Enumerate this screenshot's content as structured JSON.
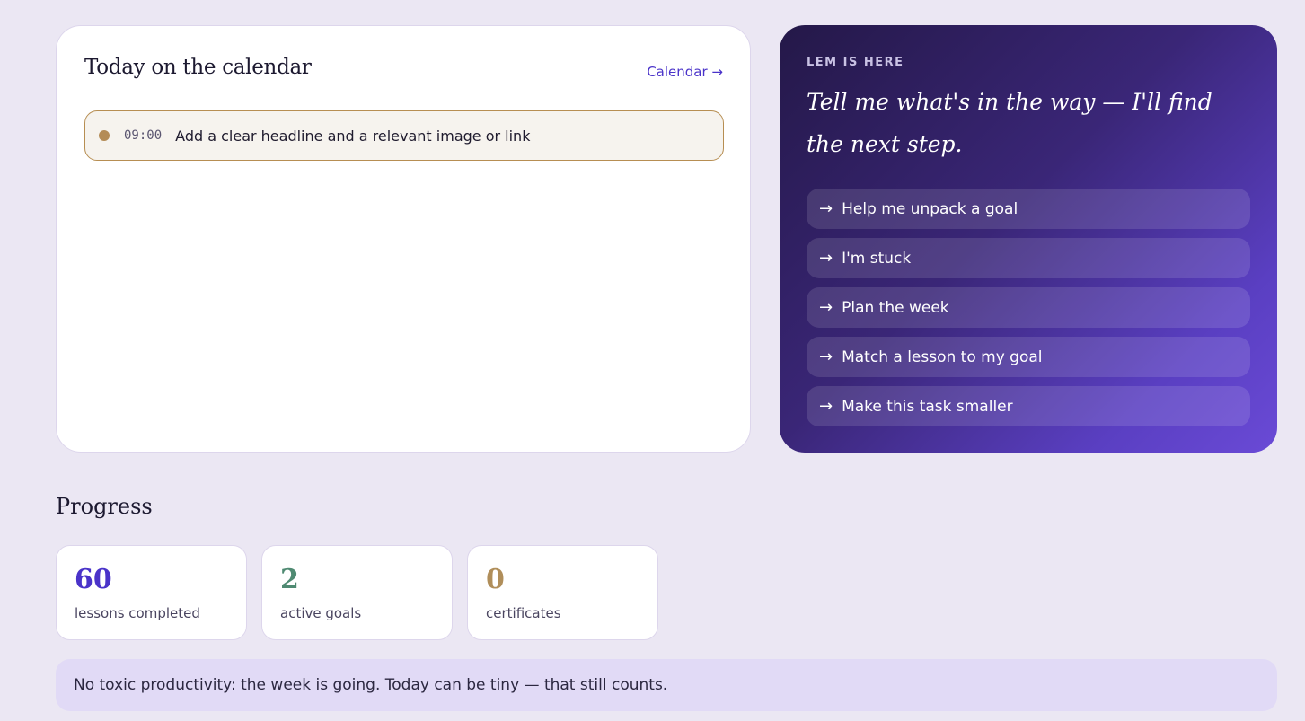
{
  "calendar": {
    "title": "Today on the calendar",
    "link_label": "Calendar →",
    "events": [
      {
        "time": "09:00",
        "text": "Add a clear headline and a relevant image or link",
        "dot_color": "#b48c57"
      }
    ]
  },
  "lem": {
    "eyebrow": "LEM IS HERE",
    "headline": "Tell me what's in the way — I'll find the next step.",
    "arrow_glyph": "→",
    "actions": [
      {
        "label": "Help me unpack a goal"
      },
      {
        "label": "I'm stuck"
      },
      {
        "label": "Plan the week"
      },
      {
        "label": "Match a lesson to my goal"
      },
      {
        "label": "Make this task smaller"
      }
    ]
  },
  "progress": {
    "title": "Progress",
    "stats": [
      {
        "value": "60",
        "label": "lessons completed",
        "color": "#4a33c9"
      },
      {
        "value": "2",
        "label": "active goals",
        "color": "#4f8a72"
      },
      {
        "value": "0",
        "label": "certificates",
        "color": "#b08e5a"
      }
    ]
  },
  "note": {
    "text": "No toxic productivity: the week is going. Today can be tiny — that still counts."
  }
}
